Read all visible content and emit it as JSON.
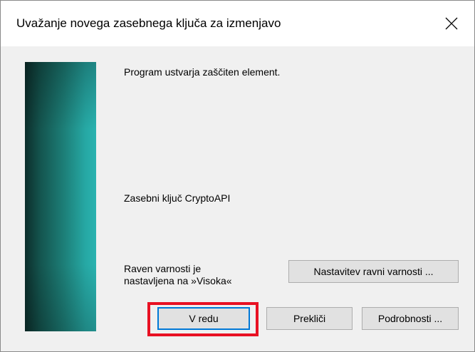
{
  "window": {
    "title": "Uvažanje novega zasebnega ključa za izmenjavo",
    "close_icon": "close-icon"
  },
  "content": {
    "message": "Program ustvarja zaščiten element.",
    "key_name": "Zasebni ključ CryptoAPI",
    "security_line1": "Raven varnosti je",
    "security_line2": "nastavljena na »Visoka«"
  },
  "buttons": {
    "set_security_level": "Nastavitev ravni varnosti ...",
    "ok": "V redu",
    "cancel": "Prekliči",
    "details": "Podrobnosti ..."
  },
  "colors": {
    "highlight": "#e81123",
    "default_button_border": "#0078d7"
  }
}
